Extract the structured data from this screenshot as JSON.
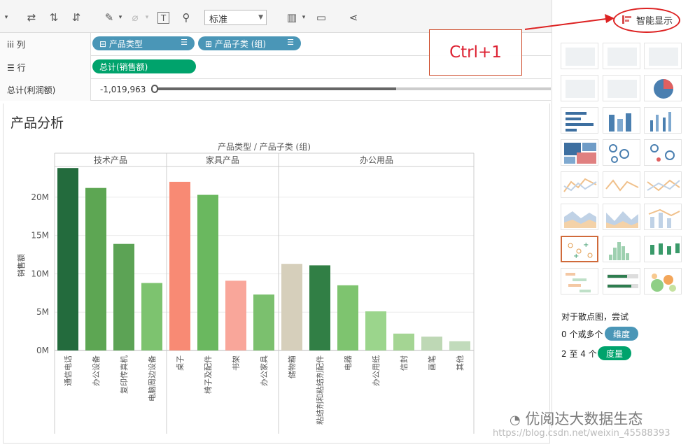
{
  "toolbar": {
    "mark_type": "标准"
  },
  "shelves": {
    "columns_label": "列",
    "columns_pills": [
      "产品类型",
      "产品子类 (组)"
    ],
    "rows_label": "行",
    "rows_pills": [
      "总计(销售额)"
    ],
    "filter_label": "总计(利润额)",
    "filter_value": "-1,019,963",
    "filter_fraction": 0.61
  },
  "worksheet": {
    "title": "产品分析"
  },
  "annotation": {
    "shortcut": "Ctrl+1"
  },
  "show_me": {
    "button_label": "智能显示",
    "hint_line1": "对于散点图，尝试",
    "hint_dim_prefix": "0 个或多个",
    "hint_dim_tag": "维度",
    "hint_meas_prefix": "2 至 4 个",
    "hint_meas_tag": "度量"
  },
  "watermark": {
    "main": "优阅达大数据生态",
    "url": "https://blog.csdn.net/weixin_45588393"
  },
  "colors": {
    "dimension": "#4a96b7",
    "measure": "#00a36c",
    "annotation_red": "#dd2222"
  },
  "chart_data": {
    "type": "bar",
    "title": "产品类型 / 产品子类 (组)",
    "ylabel": "销售额",
    "ylim": [
      0,
      24000000
    ],
    "yticks": [
      0,
      5000000,
      10000000,
      15000000,
      20000000
    ],
    "ytick_labels": [
      "0M",
      "5M",
      "10M",
      "15M",
      "20M"
    ],
    "groups": [
      {
        "name": "技术产品",
        "categories": [
          "通信电话",
          "办公设备",
          "复印传真机",
          "电脑周边设备"
        ],
        "values": [
          23800000,
          21200000,
          13900000,
          8800000
        ],
        "colors": [
          "#236b3d",
          "#5da653",
          "#5ca355",
          "#7dc36f"
        ]
      },
      {
        "name": "家具产品",
        "categories": [
          "桌子",
          "椅子及配件",
          "书架",
          "办公家具"
        ],
        "values": [
          22000000,
          20300000,
          9100000,
          7300000
        ],
        "colors": [
          "#f88a74",
          "#6ab85f",
          "#f9a69a",
          "#7bc06e"
        ]
      },
      {
        "name": "办公用品",
        "categories": [
          "储物箱",
          "粘结剂和粘结剂配件",
          "电器",
          "办公用纸",
          "信封",
          "画笔",
          "其他"
        ],
        "values": [
          11300000,
          11100000,
          8500000,
          5100000,
          2200000,
          1800000,
          1200000
        ],
        "colors": [
          "#d6cfbb",
          "#317f45",
          "#7ec46f",
          "#9bd58c",
          "#a4d593",
          "#bed8b5",
          "#c1dbbb"
        ]
      }
    ]
  }
}
